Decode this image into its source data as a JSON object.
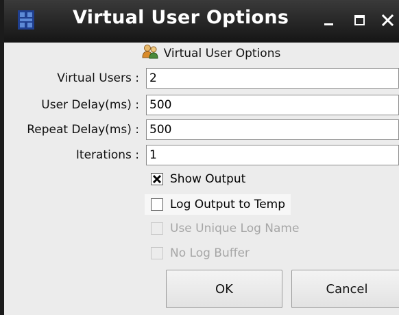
{
  "window": {
    "title": "Virtual User Options",
    "controls": [
      "minimize",
      "maximize",
      "close"
    ]
  },
  "header": {
    "icon": "users-icon",
    "label": "Virtual User Options"
  },
  "fields": [
    {
      "label": "Virtual Users :",
      "value": "2"
    },
    {
      "label": "User Delay(ms) :",
      "value": "500"
    },
    {
      "label": "Repeat Delay(ms) :",
      "value": "500"
    },
    {
      "label": "Iterations :",
      "value": "1"
    }
  ],
  "checkboxes": [
    {
      "label": "Show Output",
      "checked": true,
      "enabled": true
    },
    {
      "label": "Log Output to Temp",
      "checked": false,
      "enabled": true
    },
    {
      "label": "Use Unique Log Name",
      "checked": false,
      "enabled": false
    },
    {
      "label": "No Log Buffer",
      "checked": false,
      "enabled": false
    }
  ],
  "buttons": {
    "ok": "OK",
    "cancel": "Cancel"
  },
  "colors": {
    "titlebar": "#1f1f1f",
    "dialog_background": "#ececec",
    "disabled_text": "#a6a6a6"
  }
}
